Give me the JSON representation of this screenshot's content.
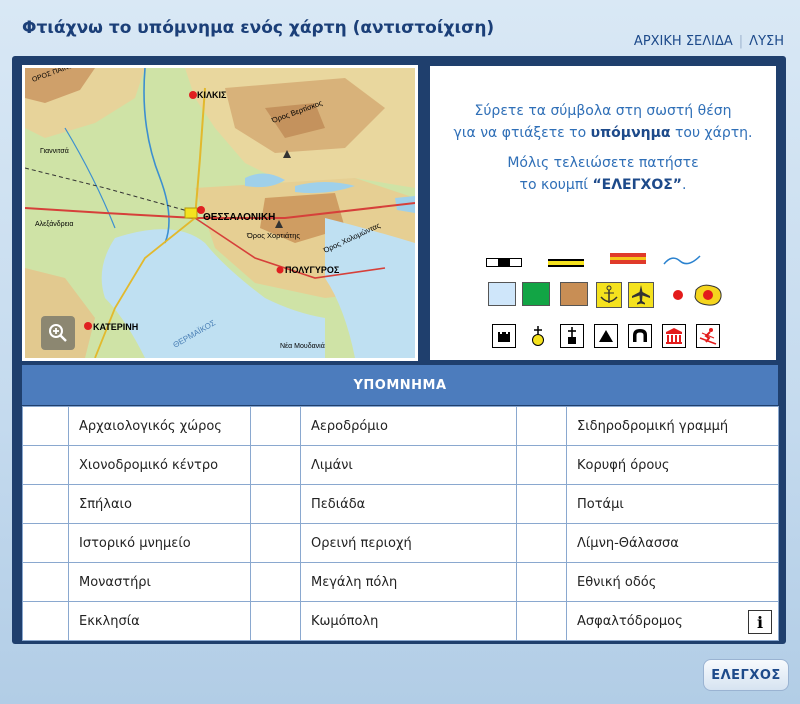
{
  "header": {
    "title": "Φτιάχνω το υπόμνημα ενός χάρτη (αντιστοίχιση)",
    "nav": {
      "home": "ΑΡΧΙΚΗ ΣΕΛΙΔΑ",
      "solution": "ΛΥΣΗ"
    }
  },
  "map": {
    "labels": {
      "kilkis": "ΚΙΛΚΙΣ",
      "thessaloniki": "ΘΕΣΣΑΛΟΝΙΚΗ",
      "katerini": "ΚΑΤΕΡΙΝΗ",
      "polygyros": "ΠΟΛΥΓΥΡΟΣ",
      "oros_chortiatis": "Όρος Χορτιάτης",
      "oros_vertiskos": "Όρος Βερτίσκος",
      "oros_cholomontas": "Όρος Χολομώντας",
      "alexandreia": "Αλεξάνδρεια",
      "giannitsa": "Γιαννιτσά",
      "nea_moudania": "Νέα Μουδανιά",
      "thermaikos": "ΘΕΡΜΑΪΚΟΣ",
      "oros_paiko": "ΟΡΟΣ ΠΑΙΚΟ"
    },
    "zoom_icon": "zoom-in-icon"
  },
  "instructions": {
    "line1": "Σύρετε τα σύμβολα στη σωστή θέση",
    "line2_pre": "για να φτιάξετε το ",
    "line2_bold": "υπόμνημα",
    "line2_post": " του χάρτη.",
    "line3": "Μόλις τελειώσετε πατήστε",
    "line4_pre": "το κουμπί ",
    "line4_bold": "“ΕΛΕΓΧΟΣ”",
    "line4_post": "."
  },
  "symbols": [
    "railway-symbol",
    "national-road-symbol",
    "paved-road-symbol",
    "river-symbol",
    "lake-sea-swatch",
    "plain-swatch",
    "mountain-area-swatch",
    "port-symbol",
    "airport-symbol",
    "town-symbol",
    "big-city-symbol",
    "historic-monument-symbol",
    "monastery-symbol",
    "church-symbol",
    "peak-symbol",
    "cave-symbol",
    "archaeological-site-symbol",
    "ski-center-symbol"
  ],
  "legend": {
    "title": "ΥΠΟΜΝΗΜΑ",
    "rows": [
      [
        "Αρχαιολογικός χώρος",
        "Αεροδρόμιο",
        "Σιδηροδρομική γραμμή"
      ],
      [
        "Χιονοδρομικό κέντρο",
        "Λιμάνι",
        "Κορυφή όρους"
      ],
      [
        "Σπήλαιο",
        "Πεδιάδα",
        "Ποτάμι"
      ],
      [
        "Ιστορικό μνημείο",
        "Ορεινή περιοχή",
        "Λίμνη-Θάλασσα"
      ],
      [
        "Μοναστήρι",
        "Μεγάλη πόλη",
        "Εθνική οδός"
      ],
      [
        "Εκκλησία",
        "Κωμόπολη",
        "Ασφαλτόδρομος"
      ]
    ],
    "info_label": "i"
  },
  "check_button": "ΕΛΕΓΧΟΣ",
  "colors": {
    "frame": "#1f3f6d",
    "legend_header": "#4c7cbd",
    "title": "#1b3f78",
    "instruction_text": "#2f6fb7"
  }
}
